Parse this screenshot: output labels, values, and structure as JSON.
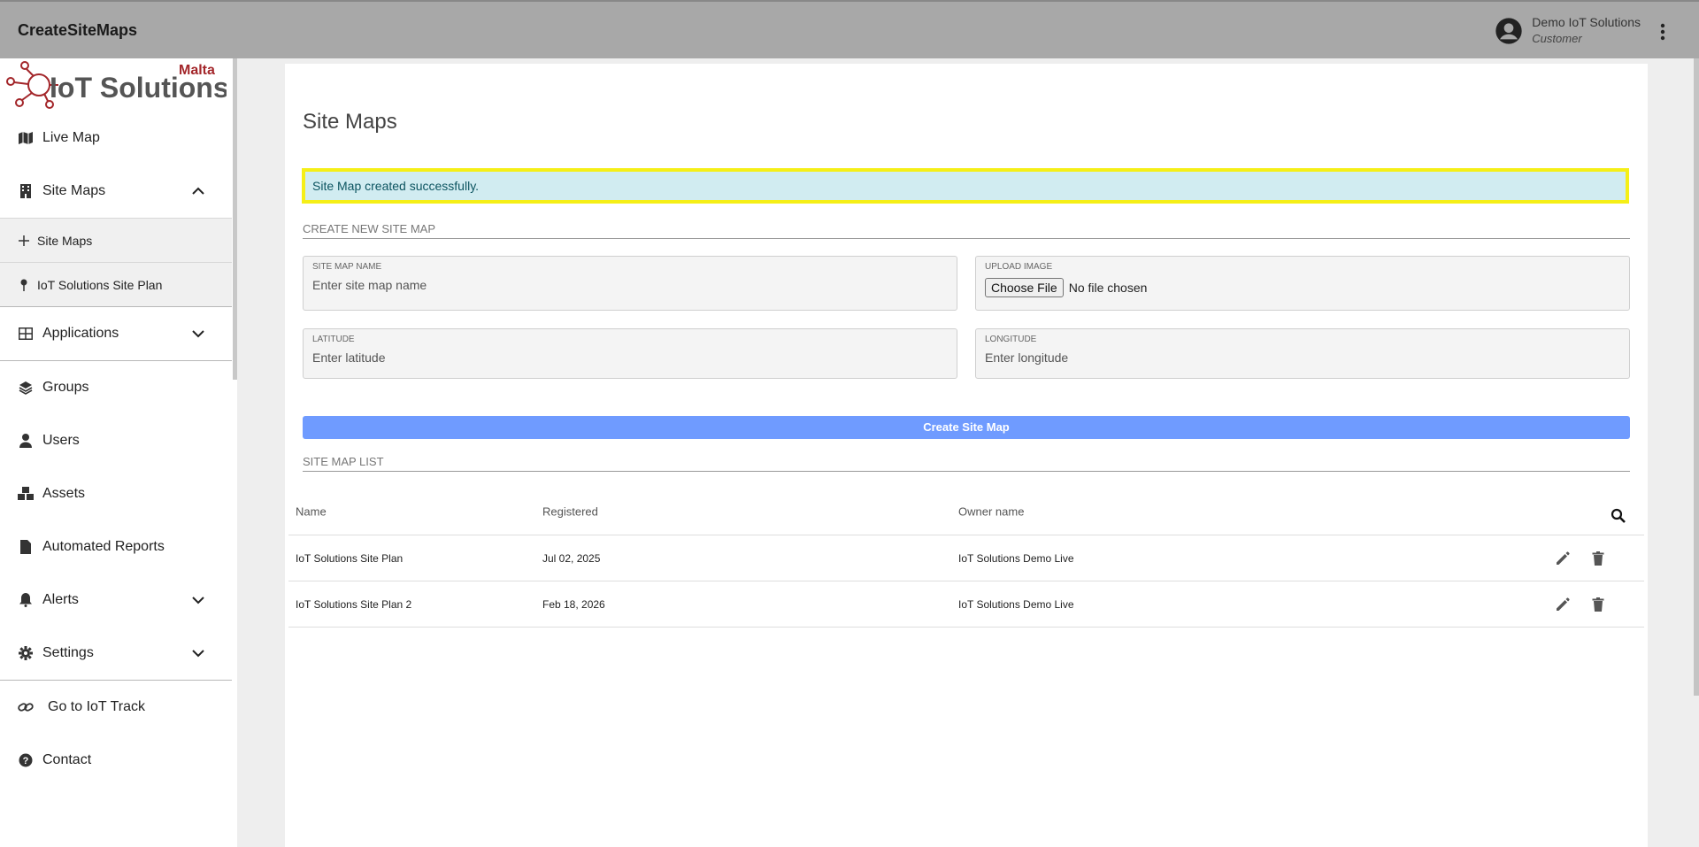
{
  "app": {
    "title": "CreateSiteMaps"
  },
  "user": {
    "name": "Demo IoT Solutions",
    "role": "Customer"
  },
  "logo": {
    "brand": "IoT Solutions",
    "region": "Malta"
  },
  "sidebar": {
    "items": [
      {
        "label": "Live Map",
        "icon": "map-icon"
      },
      {
        "label": "Site Maps",
        "icon": "building-icon",
        "expanded": true
      },
      {
        "label": "Applications",
        "icon": "grid-icon"
      },
      {
        "label": "Groups",
        "icon": "layers-icon"
      },
      {
        "label": "Users",
        "icon": "user-icon"
      },
      {
        "label": "Assets",
        "icon": "cubes-icon"
      },
      {
        "label": "Automated Reports",
        "icon": "file-icon"
      },
      {
        "label": "Alerts",
        "icon": "bell-icon"
      },
      {
        "label": "Settings",
        "icon": "gear-icon"
      },
      {
        "label": "Go to IoT Track",
        "icon": "link-icon"
      },
      {
        "label": "Contact",
        "icon": "question-icon"
      }
    ],
    "sub_items": [
      {
        "label": "Site Maps",
        "icon": "plus-icon"
      },
      {
        "label": "IoT Solutions Site Plan",
        "icon": "pin-icon"
      }
    ]
  },
  "main": {
    "title": "Site Maps",
    "alert": "Site Map created successfully.",
    "create_section": "CREATE NEW SITE MAP",
    "form": {
      "name_label": "SITE MAP NAME",
      "name_placeholder": "Enter site map name",
      "upload_label": "UPLOAD IMAGE",
      "file_button": "Choose File",
      "file_status": "No file chosen",
      "lat_label": "LATITUDE",
      "lat_placeholder": "Enter latitude",
      "lng_label": "LONGITUDE",
      "lng_placeholder": "Enter longitude",
      "submit": "Create Site Map"
    },
    "list_section": "SITE MAP LIST",
    "table": {
      "headers": [
        "Name",
        "Registered",
        "Owner name"
      ],
      "rows": [
        [
          "IoT Solutions Site Plan",
          "Jul 02, 2025",
          "IoT Solutions Demo Live"
        ],
        [
          "IoT Solutions Site Plan 2",
          "Feb 18, 2026",
          "IoT Solutions Demo Live"
        ]
      ]
    }
  },
  "colors": {
    "topbar": "#a8a8a8",
    "accent": "#6f9bff",
    "alert_bg": "#d1ecf1",
    "alert_border": "#f5ef17",
    "brand_red": "#a3262a"
  }
}
